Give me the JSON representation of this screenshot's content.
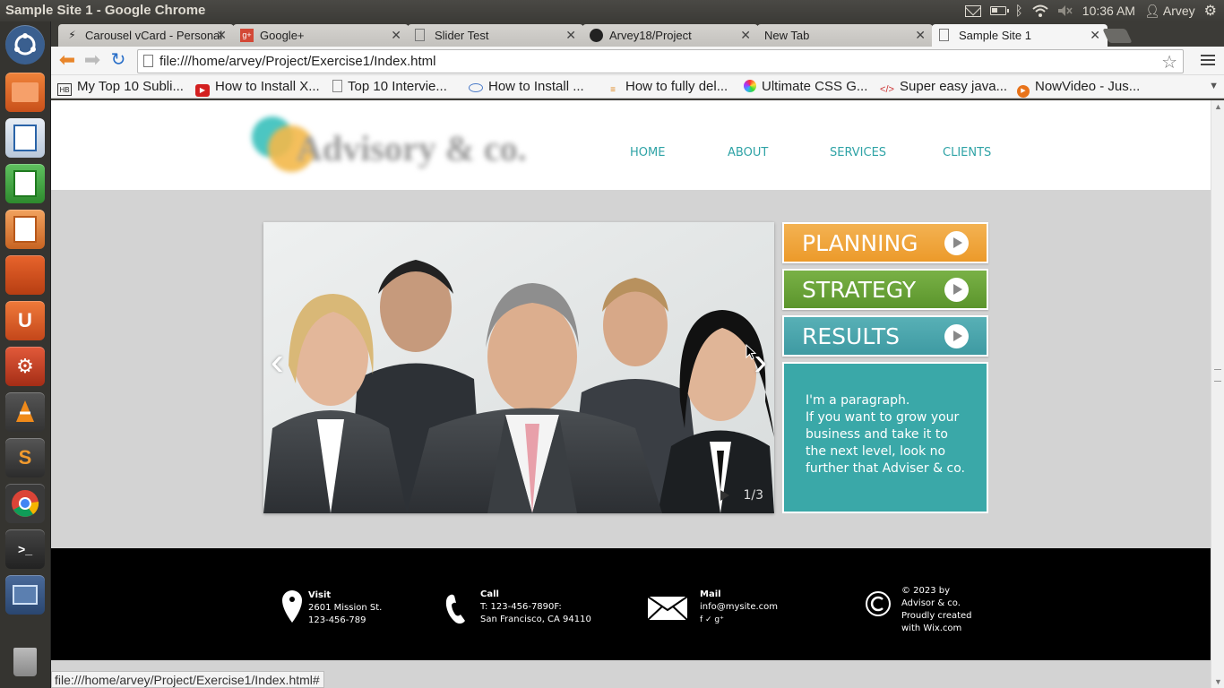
{
  "system": {
    "window_title": "Sample Site 1 - Google Chrome",
    "time": "10:36 AM",
    "user": "Arvey"
  },
  "tabs": [
    {
      "label": "Carousel vCard - Personal"
    },
    {
      "label": "Google+"
    },
    {
      "label": "Slider Test"
    },
    {
      "label": "Arvey18/Project"
    },
    {
      "label": "New Tab"
    },
    {
      "label": "Sample Site 1"
    }
  ],
  "toolbar": {
    "url": "file:///home/arvey/Project/Exercise1/Index.html"
  },
  "bookmarks": [
    {
      "label": "My Top 10 Subli...",
      "icon": "HB"
    },
    {
      "label": "How to Install X...",
      "icon": "youtube"
    },
    {
      "label": "Top 10 Intervie...",
      "icon": "page"
    },
    {
      "label": "How to Install ...",
      "icon": "cloud"
    },
    {
      "label": "How to fully del...",
      "icon": "stack"
    },
    {
      "label": "Ultimate CSS G...",
      "icon": "color-wheel"
    },
    {
      "label": "Super easy java...",
      "icon": "code"
    },
    {
      "label": "NowVideo - Jus...",
      "icon": "play"
    }
  ],
  "site": {
    "logo_text": "Advisory & co.",
    "nav": [
      "HOME",
      "ABOUT",
      "SERVICES",
      "CLIENTS"
    ],
    "slider": {
      "counter": "1/3"
    },
    "side_buttons": [
      {
        "label": "PLANNING",
        "color": "#f0a53c"
      },
      {
        "label": "STRATEGY",
        "color": "#6aa33a"
      },
      {
        "label": "RESULTS",
        "color": "#4aa4ac"
      }
    ],
    "paragraph": {
      "line1": "I'm a paragraph.",
      "line2": "If you want to grow your business and take it to the next level, look no further that Adviser & co."
    },
    "footer": {
      "visit": {
        "title": "Visit",
        "line1": "2601 Mission St.",
        "line2": "123-456-789"
      },
      "call": {
        "title": "Call",
        "line1": "T: 123-456-7890F:",
        "line2": "San Francisco, CA 94110"
      },
      "mail": {
        "title": "Mail",
        "line1": "info@mysite.com",
        "social": "f ✓ g⁺"
      },
      "copyright": {
        "line1": "© 2023 by",
        "line2": "Advisor & co.",
        "line3": "Proudly created",
        "line4": "with Wix.com"
      }
    }
  },
  "status_bar": "file:///home/arvey/Project/Exercise1/Index.html#"
}
